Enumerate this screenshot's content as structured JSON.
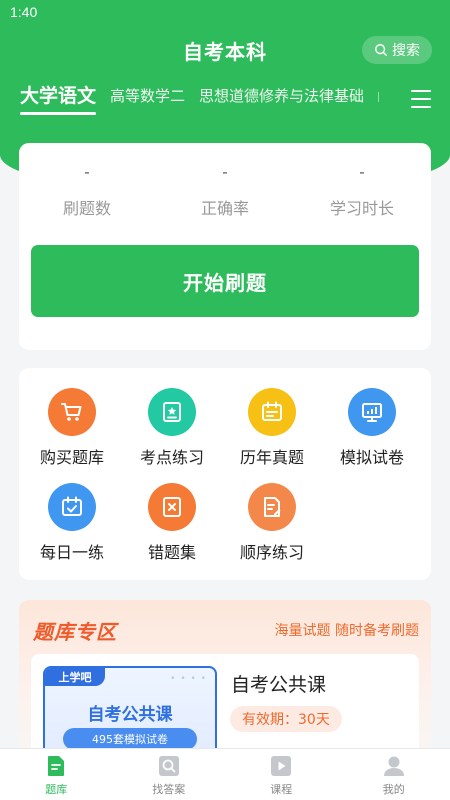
{
  "status": {
    "time": "1:40"
  },
  "header": {
    "title": "自考本科",
    "search_label": "搜索"
  },
  "subject_tabs": [
    {
      "label": "大学语文",
      "active": true
    },
    {
      "label": "高等数学二",
      "active": false
    },
    {
      "label": "思想道德修养与法律基础",
      "active": false
    }
  ],
  "stats": [
    {
      "value": "-",
      "label": "刷题数"
    },
    {
      "value": "-",
      "label": "正确率"
    },
    {
      "value": "-",
      "label": "学习时长"
    }
  ],
  "start_button": "开始刷题",
  "grid": [
    {
      "label": "购买题库",
      "icon": "cart-icon",
      "color": "#f47a36"
    },
    {
      "label": "考点练习",
      "icon": "badge-book-icon",
      "color": "#22c9a2"
    },
    {
      "label": "历年真题",
      "icon": "calendar-icon",
      "color": "#f6c015"
    },
    {
      "label": "模拟试卷",
      "icon": "presentation-icon",
      "color": "#3f97f0"
    },
    {
      "label": "每日一练",
      "icon": "calendar-check-icon",
      "color": "#3f97f0"
    },
    {
      "label": "错题集",
      "icon": "wrong-note-icon",
      "color": "#f47a36"
    },
    {
      "label": "顺序练习",
      "icon": "document-edit-icon",
      "color": "#f4884a"
    }
  ],
  "zone": {
    "title": "题库专区",
    "slogan": "海量试题 随时备考刷题",
    "course": {
      "cover_badge": "上学吧",
      "cover_title": "自考公共课",
      "cover_pill": "495套模拟试卷",
      "name": "自考公共课",
      "validity": "有效期：30天"
    }
  },
  "bottom_nav": [
    {
      "label": "题库",
      "icon": "question-bank-icon",
      "active": true
    },
    {
      "label": "找答案",
      "icon": "find-answer-icon",
      "active": false
    },
    {
      "label": "课程",
      "icon": "course-play-icon",
      "active": false
    },
    {
      "label": "我的",
      "icon": "profile-icon",
      "active": false
    }
  ],
  "colors": {
    "brand": "#2dbb5b",
    "accent_orange": "#ef5b2a",
    "cover_blue": "#2f6fe0"
  }
}
